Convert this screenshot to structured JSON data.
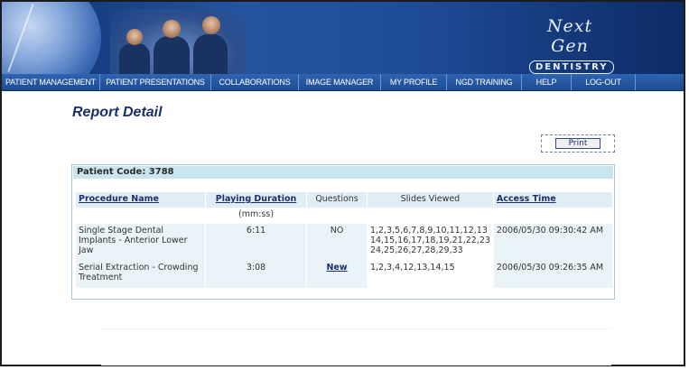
{
  "header": {
    "logo": {
      "line1": "Next Gen",
      "line2": "DENTISTRY"
    }
  },
  "nav": {
    "items": [
      {
        "label": "Patient Management",
        "name": "nav-patient-management"
      },
      {
        "label": "Patient Presentations",
        "name": "nav-patient-presentations"
      },
      {
        "label": "Collaborations",
        "name": "nav-collaborations"
      },
      {
        "label": "Image Manager",
        "name": "nav-image-manager"
      },
      {
        "label": "My Profile",
        "name": "nav-my-profile"
      },
      {
        "label": "NGD Training",
        "name": "nav-ngd-training"
      },
      {
        "label": "Help",
        "name": "nav-help"
      },
      {
        "label": "Log-Out",
        "name": "nav-log-out"
      }
    ]
  },
  "page": {
    "title": "Report Detail",
    "print_label": "Print"
  },
  "report": {
    "patient_code": "Patient Code: 3788",
    "columns": {
      "procedure": "Procedure Name",
      "duration": "Playing Duration",
      "duration_unit": "(mm:ss)",
      "questions": "Questions",
      "slides": "Slides Viewed",
      "access": "Access Time"
    },
    "rows": [
      {
        "procedure": "Single Stage Dental Implants - Anterior Lower Jaw",
        "duration": "6:11",
        "questions": "NO",
        "slides": "1,2,3,5,6,7,8,9,10,11,12,13 14,15,16,17,18,19,21,22,23 24,25,26,27,28,29,33",
        "access": "2006/05/30 09:30:42 AM"
      },
      {
        "procedure": "Serial Extraction - Crowding Treatment",
        "duration": "3:08",
        "questions": "New",
        "slides": "1,2,3,4,12,13,14,15",
        "access": "2006/05/30 09:26:35 AM"
      }
    ]
  }
}
